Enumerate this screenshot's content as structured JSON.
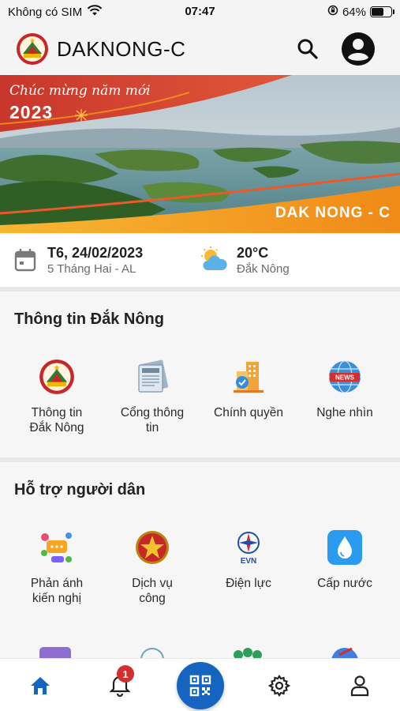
{
  "status_bar": {
    "carrier": "Không có SIM",
    "time": "07:47",
    "battery": "64%",
    "battery_level": 0.64
  },
  "header": {
    "title": "DAKNONG-C",
    "logo_icon": "province-emblem-icon",
    "search_icon": "search-icon",
    "profile_icon": "account-circle-icon"
  },
  "banner": {
    "greeting": "Chúc mừng năm mới",
    "year": "2023",
    "brand": "DAK NONG - C"
  },
  "info": {
    "date": "T6, 24/02/2023",
    "lunar_date": "5 Tháng Hai - AL",
    "temperature": "20°C",
    "location": "Đắk Nông"
  },
  "sections": [
    {
      "title": "Thông tin Đắk Nông",
      "items": [
        {
          "label": "Thông tin\nĐắk Nông",
          "icon": "province-emblem-icon"
        },
        {
          "label": "Cổng thông\ntin",
          "icon": "newspaper-icon"
        },
        {
          "label": "Chính quyền",
          "icon": "government-building-icon"
        },
        {
          "label": "Nghe nhìn",
          "icon": "news-globe-icon"
        }
      ]
    },
    {
      "title": "Hỗ trợ người dân",
      "items": [
        {
          "label": "Phản ánh\nkiến nghị",
          "icon": "feedback-chat-icon"
        },
        {
          "label": "Dịch vụ\ncông",
          "icon": "national-emblem-icon"
        },
        {
          "label": "Điện lực",
          "icon": "evn-electricity-icon"
        },
        {
          "label": "Cấp nước",
          "icon": "water-drop-icon"
        }
      ]
    }
  ],
  "evn_text": "EVN",
  "news_text": "NEWS",
  "bottom_nav": {
    "notification_count": "1",
    "items": [
      "home-icon",
      "bell-icon",
      "qr-code-icon",
      "gear-icon",
      "person-icon"
    ]
  },
  "colors": {
    "primary": "#1565c0",
    "badge": "#d32f2f",
    "banner_red": "#c8362b",
    "banner_orange": "#f39a1c"
  }
}
